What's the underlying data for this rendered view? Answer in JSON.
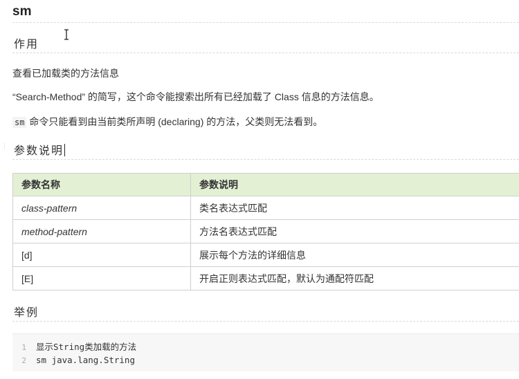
{
  "doc": {
    "title": "sm",
    "section_usage": "作用",
    "usage_line1": "查看已加载类的方法信息",
    "usage_line2": "“Search-Method” 的简写，这个命令能搜索出所有已经加载了 Class 信息的方法信息。",
    "usage_line3_code": "sm",
    "usage_line3_rest": " 命令只能看到由当前类所声明 (declaring) 的方法，父类则无法看到。",
    "section_params": "参数说明",
    "section_example": "举例"
  },
  "params_table": {
    "headers": [
      "参数名称",
      "参数说明"
    ],
    "rows": [
      {
        "name": "class-pattern",
        "desc": "类名表达式匹配"
      },
      {
        "name": "method-pattern",
        "desc": "方法名表达式匹配"
      },
      {
        "name": "[d]",
        "desc": "展示每个方法的详细信息"
      },
      {
        "name": "[E]",
        "desc": "开启正则表达式匹配，默认为通配符匹配"
      }
    ]
  },
  "example_code": {
    "lines": [
      {
        "num": "1",
        "text": "显示String类加载的方法"
      },
      {
        "num": "2",
        "text": "sm java.lang.String"
      }
    ]
  },
  "icons": {
    "text_cursor": "i-beam-cursor-icon"
  }
}
